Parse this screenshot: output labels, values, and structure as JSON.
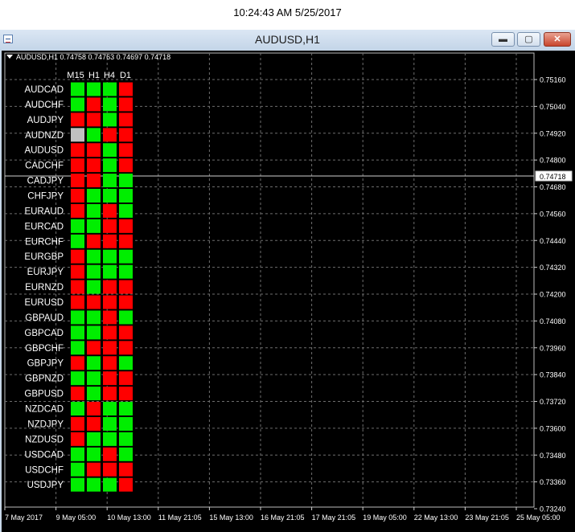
{
  "clock": "10:24:43 AM 5/25/2017",
  "window": {
    "title": "AUDUSD,H1",
    "min_icon": "minimize-icon",
    "max_icon": "maximize-icon",
    "close_icon": "close-icon"
  },
  "chart": {
    "symbol_info": "AUDUSD,H1  0.74758 0.74763 0.74697 0.74718",
    "price_marker": "0.74718",
    "price_ticks": [
      "0.75160",
      "0.75040",
      "0.74920",
      "0.74800",
      "0.74680",
      "0.74560",
      "0.74440",
      "0.74320",
      "0.74200",
      "0.74080",
      "0.73960",
      "0.73840",
      "0.73720",
      "0.73600",
      "0.73480",
      "0.73360",
      "0.73240"
    ],
    "time_ticks": [
      "7 May 2017",
      "9 May 05:00",
      "10 May 13:00",
      "11 May 21:05",
      "15 May 13:00",
      "16 May 21:05",
      "17 May 21:05",
      "19 May 05:00",
      "22 May 13:00",
      "23 May 21:05",
      "25 May 05:00"
    ],
    "colors": {
      "up": "#00ee00",
      "down": "#ff0000",
      "neutral": "#c0c0c0",
      "background": "#000000",
      "grid": "#6e6e6e"
    }
  },
  "matrix": {
    "timeframes": [
      "M15",
      "H1",
      "H4",
      "D1"
    ],
    "legend": {
      "G": "up",
      "R": "down",
      "S": "neutral"
    },
    "rows": [
      {
        "pair": "AUDCAD",
        "signals": [
          "G",
          "G",
          "G",
          "R"
        ]
      },
      {
        "pair": "AUDCHF",
        "signals": [
          "G",
          "R",
          "G",
          "R"
        ]
      },
      {
        "pair": "AUDJPY",
        "signals": [
          "R",
          "R",
          "G",
          "R"
        ]
      },
      {
        "pair": "AUDNZD",
        "signals": [
          "S",
          "G",
          "R",
          "R"
        ]
      },
      {
        "pair": "AUDUSD",
        "signals": [
          "R",
          "R",
          "G",
          "R"
        ]
      },
      {
        "pair": "CADCHF",
        "signals": [
          "R",
          "R",
          "G",
          "R"
        ]
      },
      {
        "pair": "CADJPY",
        "signals": [
          "R",
          "R",
          "G",
          "G"
        ]
      },
      {
        "pair": "CHFJPY",
        "signals": [
          "R",
          "G",
          "G",
          "G"
        ]
      },
      {
        "pair": "EURAUD",
        "signals": [
          "R",
          "G",
          "R",
          "G"
        ]
      },
      {
        "pair": "EURCAD",
        "signals": [
          "G",
          "G",
          "R",
          "R"
        ]
      },
      {
        "pair": "EURCHF",
        "signals": [
          "G",
          "R",
          "R",
          "R"
        ]
      },
      {
        "pair": "EURGBP",
        "signals": [
          "R",
          "G",
          "G",
          "G"
        ]
      },
      {
        "pair": "EURJPY",
        "signals": [
          "R",
          "G",
          "G",
          "G"
        ]
      },
      {
        "pair": "EURNZD",
        "signals": [
          "R",
          "G",
          "R",
          "R"
        ]
      },
      {
        "pair": "EURUSD",
        "signals": [
          "R",
          "R",
          "R",
          "R"
        ]
      },
      {
        "pair": "GBPAUD",
        "signals": [
          "G",
          "G",
          "R",
          "G"
        ]
      },
      {
        "pair": "GBPCAD",
        "signals": [
          "G",
          "G",
          "R",
          "R"
        ]
      },
      {
        "pair": "GBPCHF",
        "signals": [
          "G",
          "R",
          "R",
          "R"
        ]
      },
      {
        "pair": "GBPJPY",
        "signals": [
          "R",
          "G",
          "R",
          "G"
        ]
      },
      {
        "pair": "GBPNZD",
        "signals": [
          "G",
          "G",
          "R",
          "R"
        ]
      },
      {
        "pair": "GBPUSD",
        "signals": [
          "R",
          "G",
          "R",
          "R"
        ]
      },
      {
        "pair": "NZDCAD",
        "signals": [
          "G",
          "R",
          "G",
          "G"
        ]
      },
      {
        "pair": "NZDJPY",
        "signals": [
          "R",
          "R",
          "G",
          "G"
        ]
      },
      {
        "pair": "NZDUSD",
        "signals": [
          "R",
          "G",
          "G",
          "G"
        ]
      },
      {
        "pair": "USDCAD",
        "signals": [
          "G",
          "G",
          "R",
          "G"
        ]
      },
      {
        "pair": "USDCHF",
        "signals": [
          "G",
          "R",
          "R",
          "R"
        ]
      },
      {
        "pair": "USDJPY",
        "signals": [
          "G",
          "G",
          "G",
          "R"
        ]
      }
    ]
  }
}
